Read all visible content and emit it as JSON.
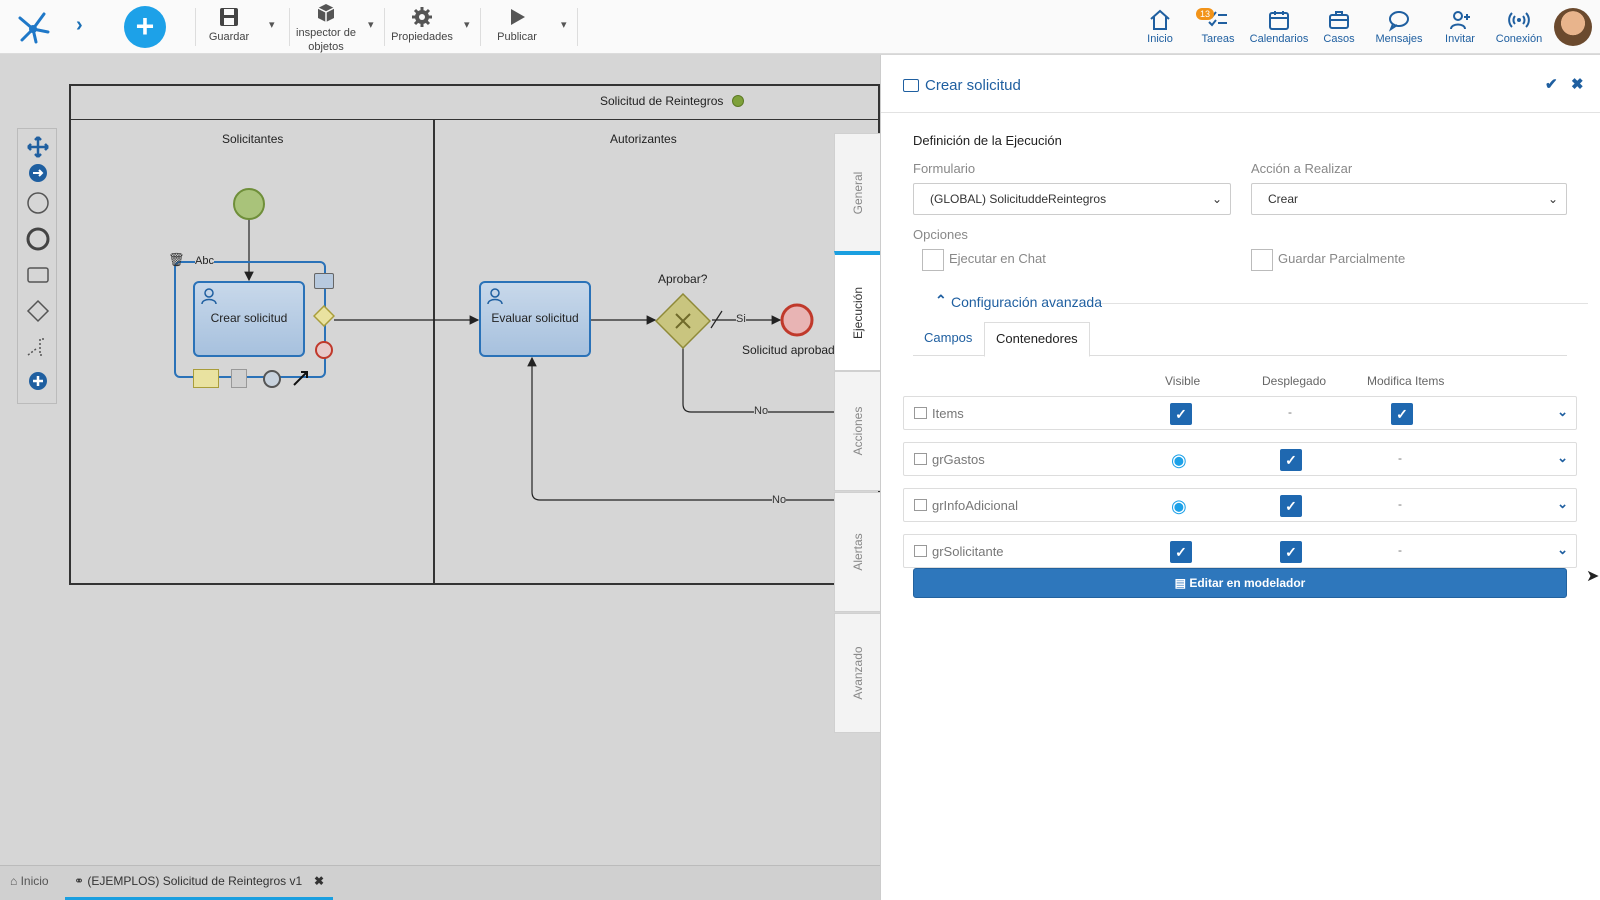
{
  "toolbar": {
    "save": "Guardar",
    "inspector_line1": "inspector de",
    "inspector_line2": "objetos",
    "properties": "Propiedades",
    "publish": "Publicar"
  },
  "nav": {
    "home": "Inicio",
    "tasks": "Tareas",
    "tasks_badge": "13",
    "calendars": "Calendarios",
    "cases": "Casos",
    "messages": "Mensajes",
    "invite": "Invitar",
    "connection": "Conexión"
  },
  "diagram": {
    "pool_title": "Solicitud de Reintegros",
    "lane_1": "Solicitantes",
    "lane_2": "Autorizantes",
    "task_1": "Crear solicitud",
    "task_2": "Evaluar solicitud",
    "task_1_text_label": "Abc",
    "gateway_label": "Aprobar?",
    "flow_yes": "Si",
    "flow_no_1": "No",
    "flow_no_2": "No",
    "end_label": "Solicitud aprobad"
  },
  "side_tabs": [
    "General",
    "Ejecución",
    "Acciones",
    "Alertas",
    "Avanzado"
  ],
  "panel": {
    "title": "Crear solicitud",
    "section_title": "Definición de la Ejecución",
    "form_label": "Formulario",
    "form_value": "(GLOBAL) SolicituddeReintegros",
    "action_label": "Acción a Realizar",
    "action_value": "Crear",
    "options_label": "Opciones",
    "opt_chat": "Ejecutar en Chat",
    "opt_partial": "Guardar Parcialmente",
    "advanced": "Configuración avanzada",
    "tab_fields": "Campos",
    "tab_containers": "Contenedores",
    "col_visible": "Visible",
    "col_deployed": "Desplegado",
    "col_modify": "Modifica Items",
    "rows": [
      {
        "name": "Items",
        "visible": "checked",
        "deployed": "-",
        "modify": "checked"
      },
      {
        "name": "grGastos",
        "visible": "conditional",
        "deployed": "checked",
        "modify": "-"
      },
      {
        "name": "grInfoAdicional",
        "visible": "conditional",
        "deployed": "checked",
        "modify": "-"
      },
      {
        "name": "grSolicitante",
        "visible": "checked",
        "deployed": "checked",
        "modify": "-"
      }
    ],
    "edit_button": "Editar en modelador"
  },
  "bottom_tabs": {
    "home": "Inicio",
    "process": "(EJEMPLOS) Solicitud de Reintegros v1"
  },
  "colors": {
    "accent": "#1f5fa0",
    "brand_blue": "#1da1e8",
    "check_blue": "#1f68b0",
    "badge_orange": "#f29318"
  }
}
